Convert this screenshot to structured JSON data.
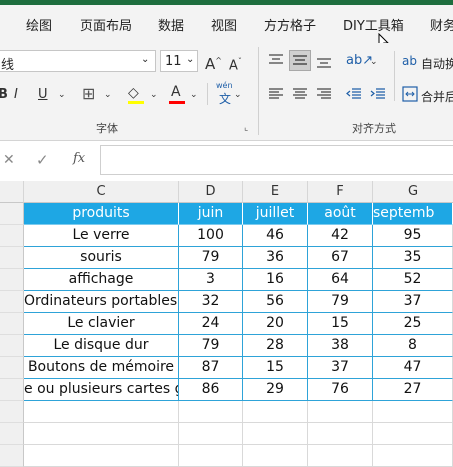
{
  "menu": {
    "tabs": [
      "绘图",
      "页面布局",
      "数据",
      "视图",
      "方方格子",
      "DIY工具箱",
      "财务"
    ]
  },
  "ribbon": {
    "font_name": "线",
    "font_size": "11",
    "font_group_label": "字体",
    "align_group_label": "对齐方式",
    "wrap_text_label": "自动换",
    "merge_label": "合并后",
    "phonetic_label": "wén",
    "phonetic_sub": "文",
    "colors": {
      "highlight": "#ffff00",
      "font_color": "#ff0000"
    }
  },
  "formula_bar": {
    "fx_label": "fx",
    "content": ""
  },
  "sheet": {
    "columns": [
      "C",
      "D",
      "E",
      "F",
      "G"
    ],
    "header_fill": "#1ea7e4",
    "headers": [
      "produits",
      "juin",
      "juillet",
      "août",
      "septemb"
    ],
    "rows": [
      [
        "Le verre",
        "100",
        "46",
        "42",
        "95"
      ],
      [
        "souris",
        "79",
        "36",
        "67",
        "35"
      ],
      [
        "affichage",
        "3",
        "16",
        "64",
        "52"
      ],
      [
        "Ordinateurs portables",
        "32",
        "56",
        "79",
        "37"
      ],
      [
        "Le clavier",
        "24",
        "20",
        "15",
        "25"
      ],
      [
        "Le disque dur",
        "79",
        "28",
        "38",
        "8"
      ],
      [
        "Boutons de mémoire",
        "87",
        "15",
        "37",
        "47"
      ],
      [
        "e ou plusieurs cartes grap",
        "86",
        "29",
        "76",
        "27"
      ]
    ]
  }
}
